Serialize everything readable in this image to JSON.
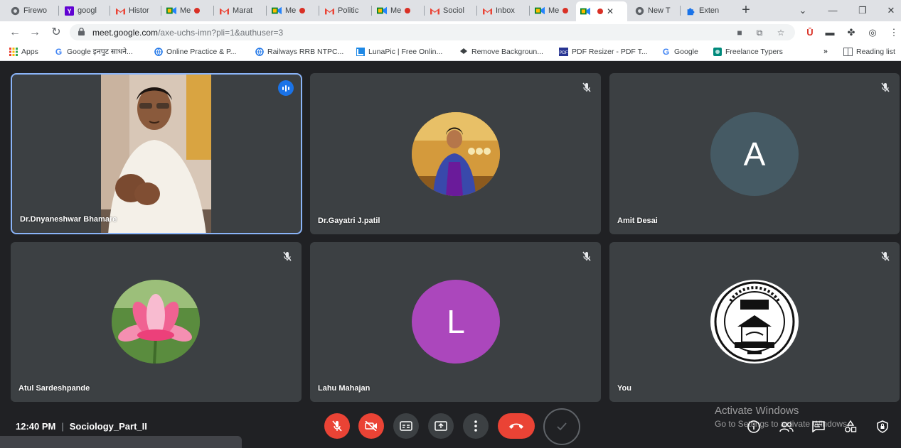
{
  "browser": {
    "tabs": [
      {
        "title": "Firewo",
        "icon": "chrome-icon",
        "recording": false
      },
      {
        "title": "googl",
        "icon": "yahoo-icon",
        "recording": false
      },
      {
        "title": "Histor",
        "icon": "gmail-icon",
        "recording": false
      },
      {
        "title": "Me",
        "icon": "meet-icon",
        "recording": true
      },
      {
        "title": "Marat",
        "icon": "gmail-icon",
        "recording": false
      },
      {
        "title": "Me",
        "icon": "meet-icon",
        "recording": true
      },
      {
        "title": "Politic",
        "icon": "gmail-icon",
        "recording": false
      },
      {
        "title": "Me",
        "icon": "meet-icon",
        "recording": true
      },
      {
        "title": "Sociol",
        "icon": "gmail-icon",
        "recording": false
      },
      {
        "title": "Inbox",
        "icon": "gmail-icon",
        "recording": false
      },
      {
        "title": "Me",
        "icon": "meet-icon",
        "recording": true
      },
      {
        "title": "",
        "icon": "meet-icon",
        "recording": true,
        "active": true
      },
      {
        "title": "New T",
        "icon": "chrome-icon",
        "recording": false
      },
      {
        "title": "Exten",
        "icon": "puzzle-icon",
        "recording": false
      }
    ],
    "url_host": "meet.google.com",
    "url_path": "/axe-uchs-imn?pli=1&authuser=3",
    "bookmarks": [
      {
        "label": "Apps",
        "icon": "apps-grid-icon"
      },
      {
        "label": "Google इनपुट साधने...",
        "icon": "google-icon"
      },
      {
        "label": "Online Practice & P...",
        "icon": "globe-icon"
      },
      {
        "label": "Railways RRB NTPC...",
        "icon": "globe-icon"
      },
      {
        "label": "LunaPic | Free Onlin...",
        "icon": "lunapic-icon"
      },
      {
        "label": "Remove Backgroun...",
        "icon": "removebg-icon"
      },
      {
        "label": "PDF Resizer - PDF T...",
        "icon": "pdf-icon"
      },
      {
        "label": "Google",
        "icon": "google-icon"
      },
      {
        "label": "Freelance Typers",
        "icon": "freelance-icon"
      }
    ],
    "bookmarks_more": "»",
    "reading_list": "Reading list"
  },
  "meeting": {
    "participants": [
      {
        "name": "Dr.Dnyaneshwar Bhamare",
        "mode": "video",
        "speaking": true
      },
      {
        "name": "Dr.Gayatri J.patil",
        "mode": "photo",
        "muted": true
      },
      {
        "name": "Amit Desai",
        "mode": "initial",
        "initial": "A",
        "color": "#455a64",
        "muted": true
      },
      {
        "name": "Atul Sardeshpande",
        "mode": "lotus",
        "muted": true
      },
      {
        "name": "Lahu Mahajan",
        "mode": "initial",
        "initial": "L",
        "color": "#ab47bc",
        "muted": true
      },
      {
        "name": "You",
        "mode": "emblem",
        "muted": true
      }
    ],
    "time": "12:40 PM",
    "separator": "|",
    "meeting_name": "Sociology_Part_II",
    "watermark_title": "Activate Windows",
    "watermark_sub": "Go to Settings to activate Windows."
  },
  "colors": {
    "accent": "#1a73e8",
    "danger": "#ea4335",
    "tile": "#3c4043",
    "background": "#202124"
  }
}
